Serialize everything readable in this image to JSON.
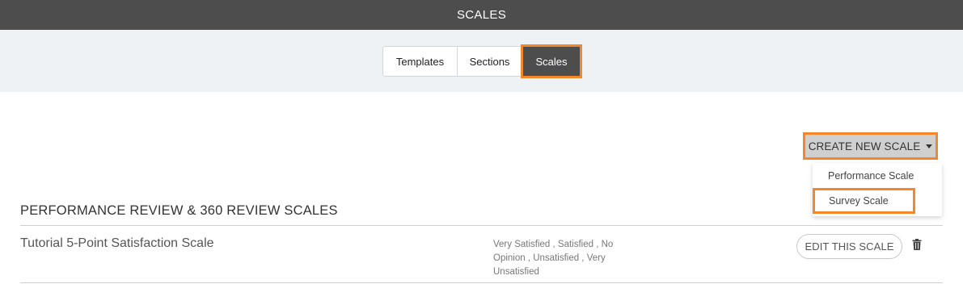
{
  "header": {
    "title": "SCALES"
  },
  "tabs": [
    {
      "label": "Templates",
      "active": false
    },
    {
      "label": "Sections",
      "active": false
    },
    {
      "label": "Scales",
      "active": true
    }
  ],
  "create_button": {
    "label": "CREATE NEW SCALE",
    "icon": "caret-down-icon"
  },
  "dropdown": {
    "items": [
      {
        "label": "Performance Scale"
      },
      {
        "label": "Survey Scale"
      }
    ]
  },
  "section": {
    "title": "PERFORMANCE REVIEW & 360 REVIEW SCALES",
    "rows": [
      {
        "name": "Tutorial 5-Point Satisfaction Scale",
        "values_line1": "Very Satisfied , Satisfied , No",
        "values_line2": "Opinion , Unsatisfied , Very",
        "values_line3": "Unsatisfied",
        "edit_label": "EDIT THIS SCALE",
        "delete_icon": "trash-icon"
      }
    ]
  },
  "colors": {
    "topbar": "#4d4d4d",
    "tab_band": "#eef2f4",
    "highlight": "#f5862a",
    "active_tab": "#4d4d4d"
  }
}
